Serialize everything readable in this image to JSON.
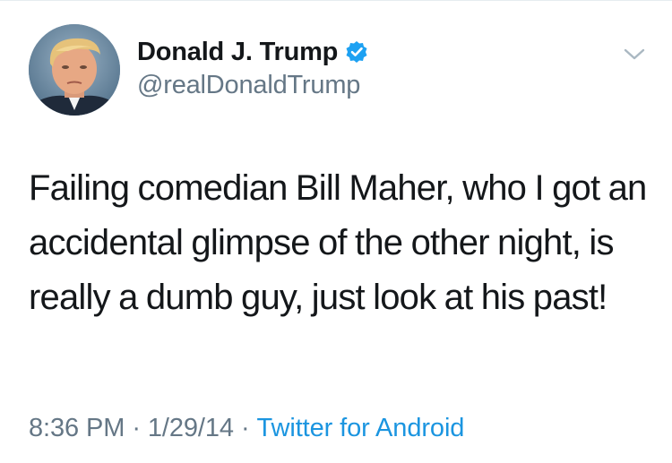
{
  "tweet": {
    "author": {
      "display_name": "Donald J. Trump",
      "handle": "@realDonaldTrump",
      "verified": true,
      "avatar_icon": "profile-photo"
    },
    "text": "Failing comedian Bill Maher, who I got an accidental glimpse of the other night, is really a dumb guy, just look at his past!",
    "time": "8:36 PM",
    "date": "1/29/14",
    "source": "Twitter for Android",
    "separator": "·",
    "menu_icon": "chevron-down-icon"
  },
  "colors": {
    "text": "#14171a",
    "secondary": "#657786",
    "link": "#1b95e0",
    "verified_badge": "#1da1f2"
  }
}
